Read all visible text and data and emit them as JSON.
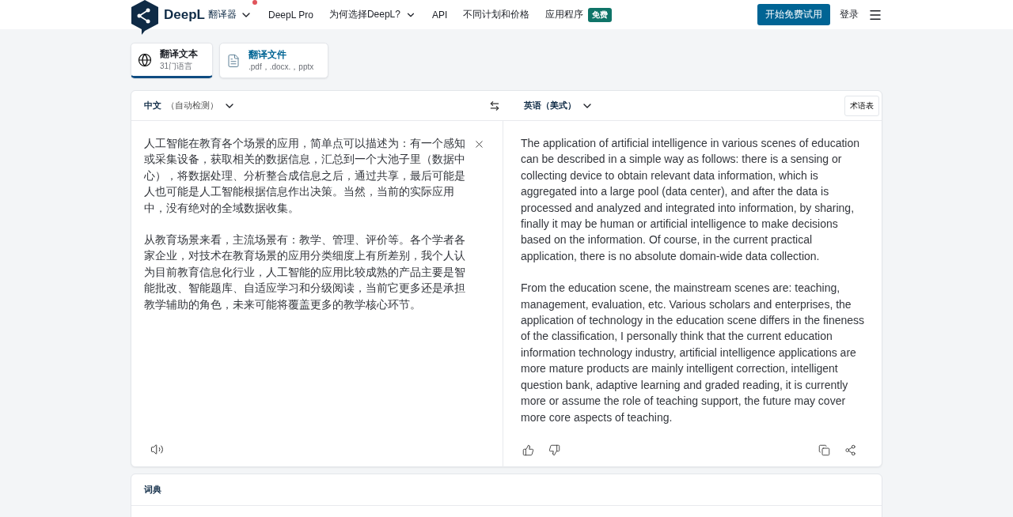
{
  "header": {
    "brand": "DeepL",
    "product": "翻译器",
    "has_notification": true,
    "nav": [
      {
        "label": "DeepL Pro",
        "dropdown": false
      },
      {
        "label": "为何选择DeepL?",
        "dropdown": true
      },
      {
        "label": "API",
        "dropdown": false
      },
      {
        "label": "不同计划和价格",
        "dropdown": false
      },
      {
        "label": "应用程序",
        "dropdown": false,
        "badge": "免费"
      }
    ],
    "cta": "开始免费试用",
    "login": "登录"
  },
  "mode_tabs": [
    {
      "kind": "text",
      "title": "翻译文本",
      "subtitle": "31门语言",
      "selected": true
    },
    {
      "kind": "file",
      "title": "翻译文件",
      "subtitle": ".pdf，.docx.，pptx",
      "selected": false
    }
  ],
  "translator": {
    "source_language": "中文",
    "source_note": "（自动检测）",
    "target_language": "英语（美式）",
    "glossary": "术语表",
    "source_paragraphs": [
      "人工智能在教育各个场景的应用，简单点可以描述为：有一个感知或采集设备，获取相关的数据信息，汇总到一个大池子里（数据中心），将数据处理、分析整合成信息之后，通过共享，最后可能是人也可能是人工智能根据信息作出决策。当然，当前的实际应用中，没有绝对的全域数据收集。",
      "从教育场景来看，主流场景有：教学、管理、评价等。各个学者各家企业，对技术在教育场景的应用分类细度上有所差别，我个人认为目前教育信息化行业，人工智能的应用比较成熟的产品主要是智能批改、智能题库、自适应学习和分级阅读，当前它更多还是承担教学辅助的角色，未来可能将覆盖更多的教学核心环节。"
    ],
    "target_paragraphs": [
      "The application of artificial intelligence in various scenes of education can be described in a simple way as follows: there is a sensing or collecting device to obtain relevant data information, which is aggregated into a large pool (data center), and after the data is processed and analyzed and integrated into information, by sharing, finally it may be human or artificial intelligence to make decisions based on the information. Of course, in the current practical application, there is no absolute domain-wide data collection.",
      "From the education scene, the mainstream scenes are: teaching, management, evaluation, etc. Various scholars and enterprises, the application of technology in the education scene differs in the fineness of the classification, I personally think that the current education information technology industry, artificial intelligence applications are more mature products are mainly intelligent correction, intelligent question bank, adaptive learning and graded reading, it is currently more or assume the role of teaching support, the future may cover more core aspects of teaching."
    ]
  },
  "dictionary": {
    "title": "词典"
  }
}
